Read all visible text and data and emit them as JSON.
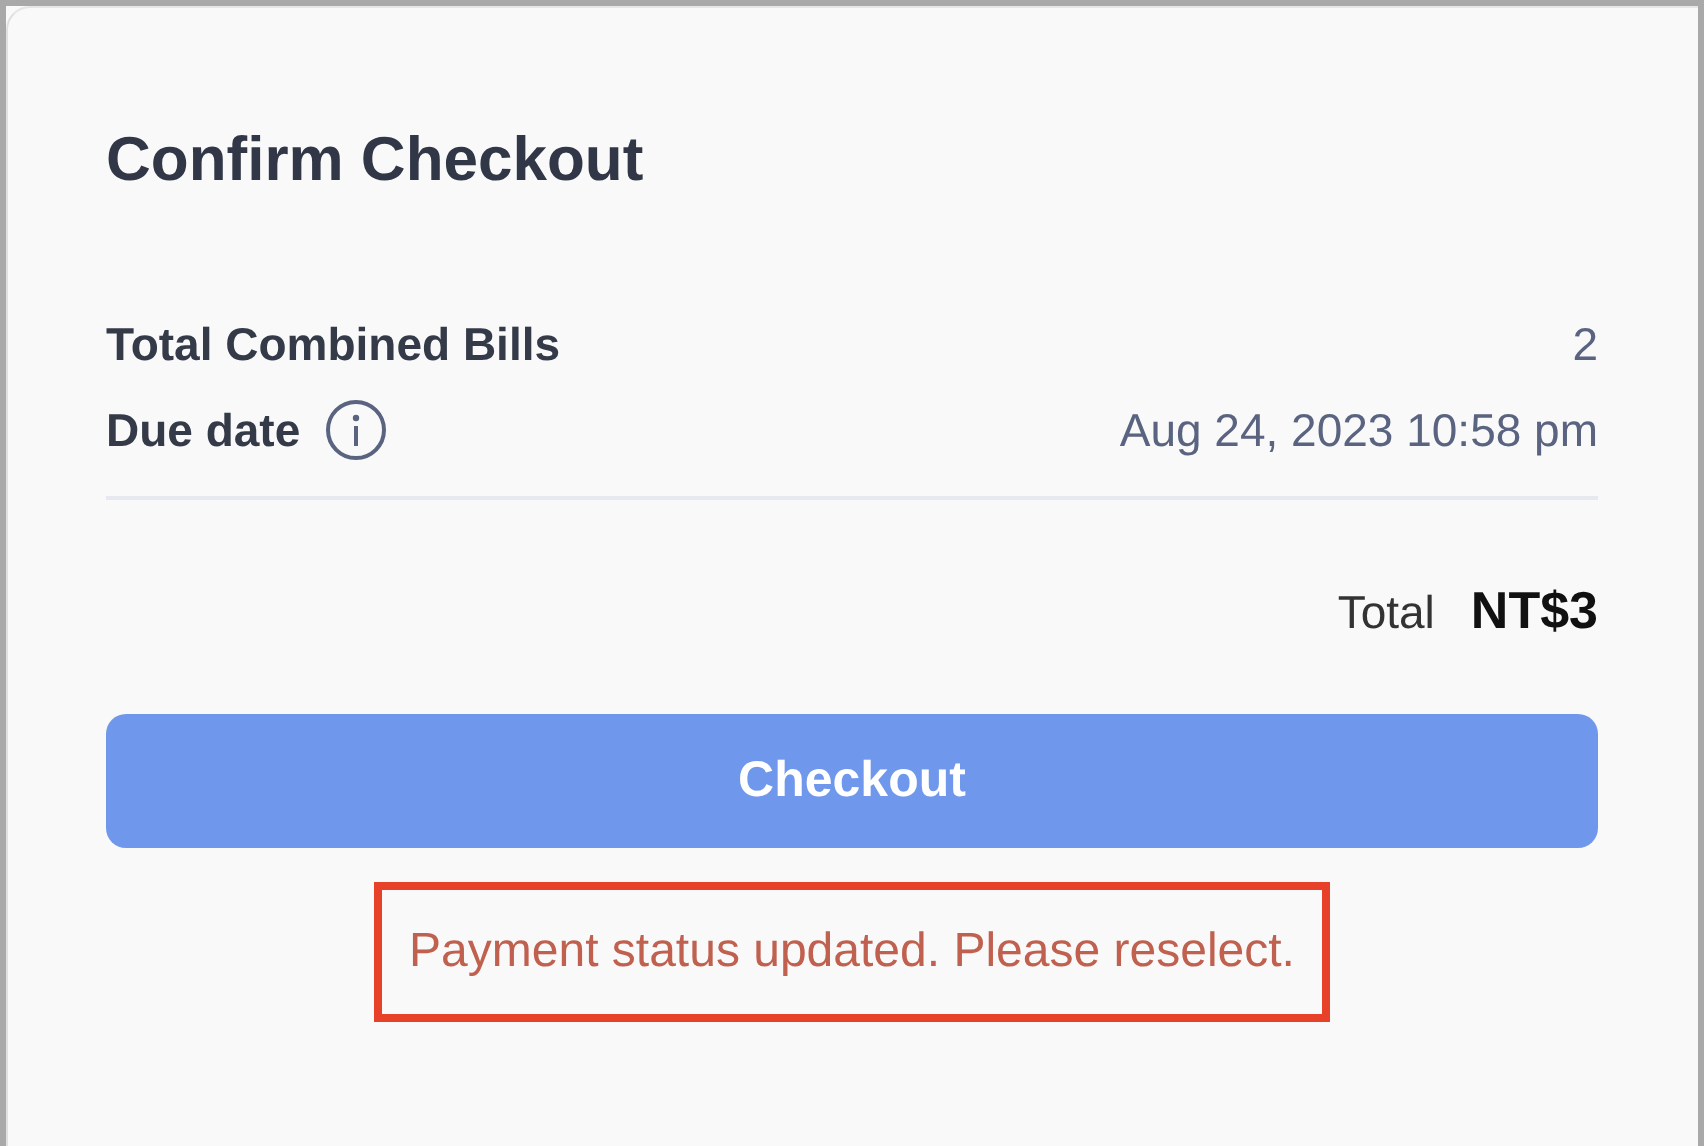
{
  "title": "Confirm Checkout",
  "rows": [
    {
      "label": "Total Combined Bills",
      "value": "2",
      "info": false
    },
    {
      "label": "Due date",
      "value": "Aug 24, 2023 10:58 pm",
      "info": true
    }
  ],
  "total": {
    "label": "Total",
    "amount": "NT$3"
  },
  "checkout_button": {
    "label": "Checkout",
    "disabled": true
  },
  "message": {
    "text": "Payment status updated. Please reselect.",
    "highlighted": true
  }
}
